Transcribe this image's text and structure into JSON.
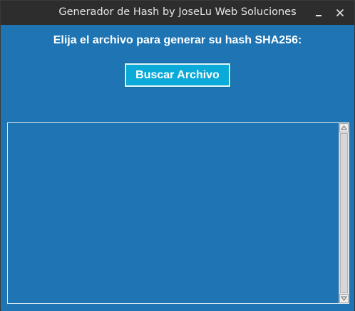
{
  "window": {
    "title": "Generador de Hash by JoseLu Web Soluciones",
    "background_color": "#1f75b3",
    "titlebar_color": "#2d2d2d",
    "controls": {
      "minimize_icon": "minimize-icon",
      "close_label": "✕",
      "close_icon": "close-icon"
    }
  },
  "main": {
    "prompt": "Elija el archivo para generar su hash SHA256:",
    "browse_button": {
      "label": "Buscar Archivo",
      "color": "#0aaad9"
    },
    "output": {
      "value": "",
      "scrollbar": {
        "up_icon": "chevron-up-icon",
        "down_icon": "chevron-down-icon"
      }
    }
  }
}
